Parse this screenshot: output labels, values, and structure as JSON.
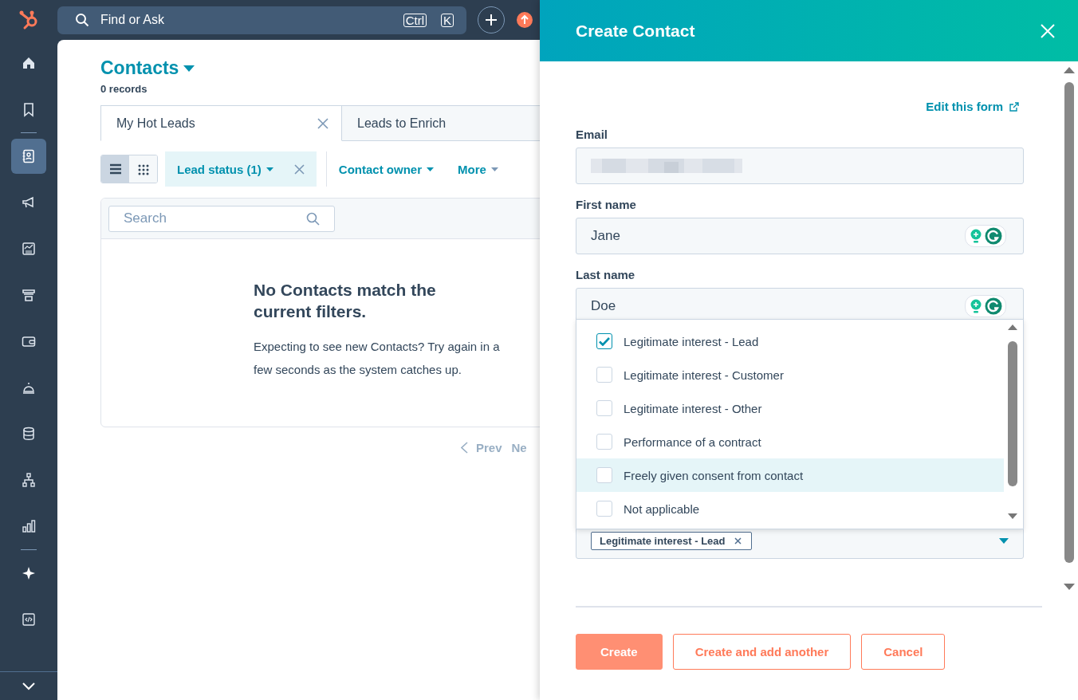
{
  "sidebar": {
    "items": [
      {
        "kind": "link",
        "selected": false
      },
      {
        "kind": "link",
        "selected": false
      },
      {
        "kind": "divider"
      },
      {
        "kind": "link",
        "selected": true
      },
      {
        "kind": "link",
        "selected": false
      },
      {
        "kind": "link",
        "selected": false
      },
      {
        "kind": "link",
        "selected": false
      },
      {
        "kind": "link",
        "selected": false
      },
      {
        "kind": "link",
        "selected": false
      },
      {
        "kind": "link",
        "selected": false
      },
      {
        "kind": "link",
        "selected": false
      },
      {
        "kind": "link",
        "selected": false
      },
      {
        "kind": "divider"
      },
      {
        "kind": "link",
        "selected": false
      },
      {
        "kind": "link",
        "selected": false
      }
    ]
  },
  "top_bar": {
    "search": {
      "placeholder": "Find or Ask"
    },
    "shortcut_keys": [
      "Ctrl",
      "K"
    ]
  },
  "page": {
    "title": "Contacts",
    "record_count": "0 records",
    "tabs": [
      {
        "label": "My Hot Leads",
        "selected": true,
        "closable": true
      },
      {
        "label": "Leads to Enrich",
        "selected": false,
        "closable": false
      }
    ],
    "view_toggles": [
      {
        "selected": true
      },
      {
        "selected": false
      }
    ],
    "filters": [
      {
        "label": "Lead status (1)",
        "active": true
      },
      {
        "label": "Contact owner",
        "active": false
      },
      {
        "label": "More",
        "active": false
      }
    ],
    "search": {
      "placeholder": "Search"
    },
    "empty_state": {
      "title": "No Contacts match the current filters.",
      "text": "Expecting to see new Contacts? Try again in a few seconds as the system catches up."
    },
    "pagination": {
      "prev": "Prev",
      "next": "Ne"
    }
  },
  "create_panel": {
    "title": "Create Contact",
    "edit_link": "Edit this form",
    "fields": [
      {
        "label": "Email",
        "kind": "redacted",
        "writing_assistant": false
      },
      {
        "label": "First name",
        "kind": "text",
        "value": "Jane",
        "writing_assistant": true
      },
      {
        "label": "Last name",
        "kind": "text",
        "value": "Doe",
        "writing_assistant": true
      }
    ],
    "dropdown": {
      "options": [
        {
          "label": "Legitimate interest - Lead",
          "checked": true,
          "highlighted": false
        },
        {
          "label": "Legitimate interest - Customer",
          "checked": false,
          "highlighted": false
        },
        {
          "label": "Legitimate interest - Other",
          "checked": false,
          "highlighted": false
        },
        {
          "label": "Performance of a contract",
          "checked": false,
          "highlighted": false
        },
        {
          "label": "Freely given consent from contact",
          "checked": false,
          "highlighted": true
        },
        {
          "label": "Not applicable",
          "checked": false,
          "highlighted": false
        }
      ]
    },
    "tags": [
      "Legitimate interest - Lead"
    ],
    "buttons": [
      {
        "label": "Create",
        "kind": "primary"
      },
      {
        "label": "Create and add another",
        "kind": "secondary"
      },
      {
        "label": "Cancel",
        "kind": "secondary"
      }
    ]
  }
}
